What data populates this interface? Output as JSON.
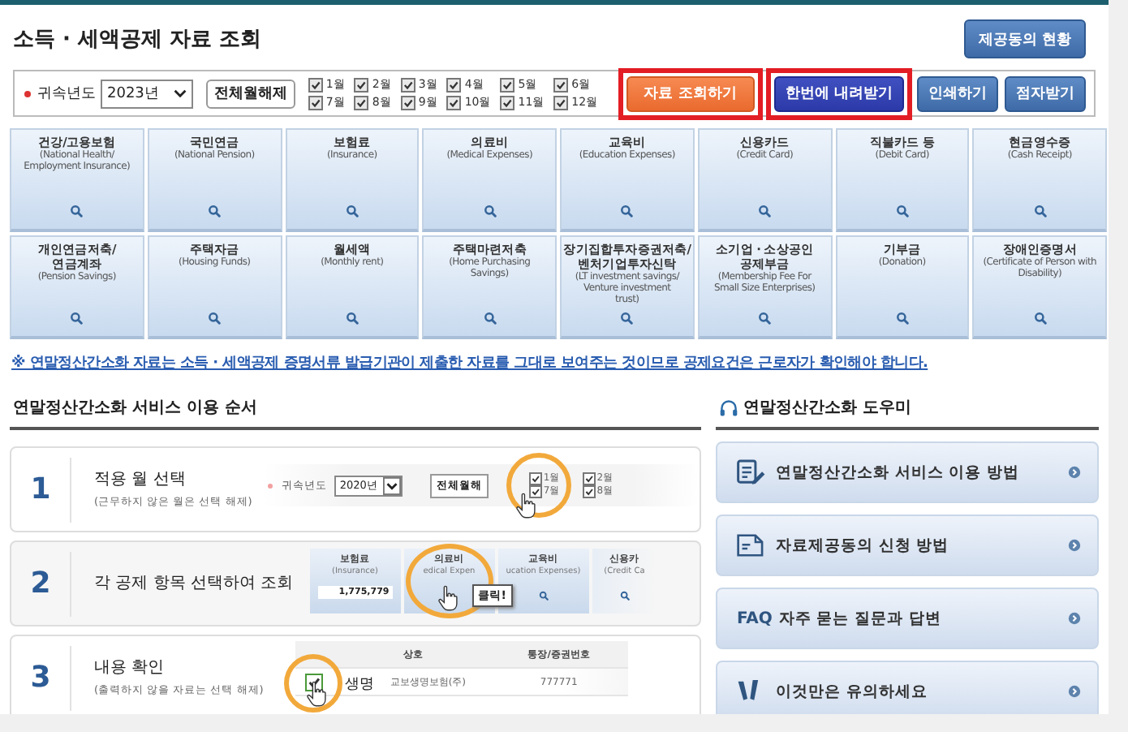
{
  "page_title": "소득 · 세액공제 자료 조회",
  "status_button": "제공동의 현황",
  "filter": {
    "year_label": "귀속년도",
    "year_value": "2023년",
    "toggle_button": "전체월해제",
    "months": [
      {
        "label": "1월",
        "checked": true
      },
      {
        "label": "2월",
        "checked": true
      },
      {
        "label": "3월",
        "checked": true
      },
      {
        "label": "4월",
        "checked": true
      },
      {
        "label": "5월",
        "checked": true
      },
      {
        "label": "6월",
        "checked": true
      },
      {
        "label": "7월",
        "checked": true
      },
      {
        "label": "8월",
        "checked": true
      },
      {
        "label": "9월",
        "checked": true
      },
      {
        "label": "10월",
        "checked": true
      },
      {
        "label": "11월",
        "checked": true
      },
      {
        "label": "12월",
        "checked": true
      }
    ]
  },
  "actions": [
    {
      "label": "자료 조회하기",
      "kind": "orange",
      "highlighted": true
    },
    {
      "label": "한번에 내려받기",
      "kind": "navy",
      "highlighted": true
    },
    {
      "label": "인쇄하기",
      "kind": "blue",
      "highlighted": false
    },
    {
      "label": "점자받기",
      "kind": "blue",
      "highlighted": false
    }
  ],
  "categories": [
    {
      "title": "건강/고용보험",
      "subtitle": "(National Health/\nEmployment Insurance)"
    },
    {
      "title": "국민연금",
      "subtitle": "(National Pension)"
    },
    {
      "title": "보험료",
      "subtitle": "(Insurance)"
    },
    {
      "title": "의료비",
      "subtitle": "(Medical Expenses)"
    },
    {
      "title": "교육비",
      "subtitle": "(Education Expenses)"
    },
    {
      "title": "신용카드",
      "subtitle": "(Credit Card)"
    },
    {
      "title": "직불카드 등",
      "subtitle": "(Debit Card)"
    },
    {
      "title": "현금영수증",
      "subtitle": "(Cash Receipt)"
    },
    {
      "title": "개인연금저축/\n연금계좌",
      "subtitle": "(Pension Savings)"
    },
    {
      "title": "주택자금",
      "subtitle": "(Housing Funds)"
    },
    {
      "title": "월세액",
      "subtitle": "(Monthly rent)"
    },
    {
      "title": "주택마련저축",
      "subtitle": "(Home Purchasing\nSavings)"
    },
    {
      "title": "장기집합투자증권저축/\n벤처기업투자신탁",
      "subtitle": "(LT investment savings/\nVenture investment\ntrust)"
    },
    {
      "title": "소기업 · 소상공인\n공제부금",
      "subtitle": "(Membership Fee For\nSmall Size Enterprises)"
    },
    {
      "title": "기부금",
      "subtitle": "(Donation)"
    },
    {
      "title": "장애인증명서",
      "subtitle": "(Certificate of Person with\nDisability)"
    }
  ],
  "notice": "※ 연말정산간소화 자료는 소득 · 세액공제 증명서류 발급기관이 제출한 자료를 그대로 보여주는 것이므로 공제요건은 근로자가 확인해야 합니다.",
  "guide": {
    "title": "연말정산간소화 서비스 이용 순서",
    "steps": [
      {
        "number": "1",
        "title": "적용 월 선택",
        "note": "(근무하지 않은 월은 선택 해제)",
        "kind": "months",
        "preview": {
          "year_label": "귀속년도",
          "year_value": "2020년",
          "toggle_button": "전체월해",
          "months": [
            {
              "label": "1월",
              "checked": true
            },
            {
              "label": "7월",
              "checked": true
            },
            {
              "label": "2월",
              "checked": true
            },
            {
              "label": "8월",
              "checked": true
            }
          ]
        }
      },
      {
        "number": "2",
        "title": "각 공제 항목 선택하여 조회",
        "kind": "cards",
        "preview": {
          "callout": "클릭!",
          "cards": [
            {
              "title": "보험료",
              "subtitle": "(Insurance)",
              "amount": "1,775,779"
            },
            {
              "title": "의료비",
              "subtitle": "edical Expen"
            },
            {
              "title": "교육비",
              "subtitle": "ucation Expenses)"
            },
            {
              "title": "신용카",
              "subtitle": "(Credit Ca"
            }
          ]
        }
      },
      {
        "number": "3",
        "title": "내용 확인",
        "note": "(출력하지 않을 자료는 선택 해제)",
        "kind": "table",
        "preview": {
          "columns": [
            "상호",
            "통장/증권번호"
          ],
          "magnified_label": "생명",
          "rows": [
            {
              "checked": true,
              "cells": [
                "교보생명보험(주)",
                "777771"
              ]
            }
          ]
        }
      }
    ]
  },
  "help": {
    "title": "연말정산간소화 도우미",
    "items": [
      {
        "label": "연말정산간소화 서비스 이용 방법",
        "kind": "document"
      },
      {
        "label": "자료제공동의 신청 방법",
        "kind": "form"
      },
      {
        "label": "자주 묻는 질문과 답변",
        "kind": "faq",
        "prefix": "FAQ"
      },
      {
        "label": "이것만은 유의하세요",
        "kind": "alert"
      }
    ]
  }
}
